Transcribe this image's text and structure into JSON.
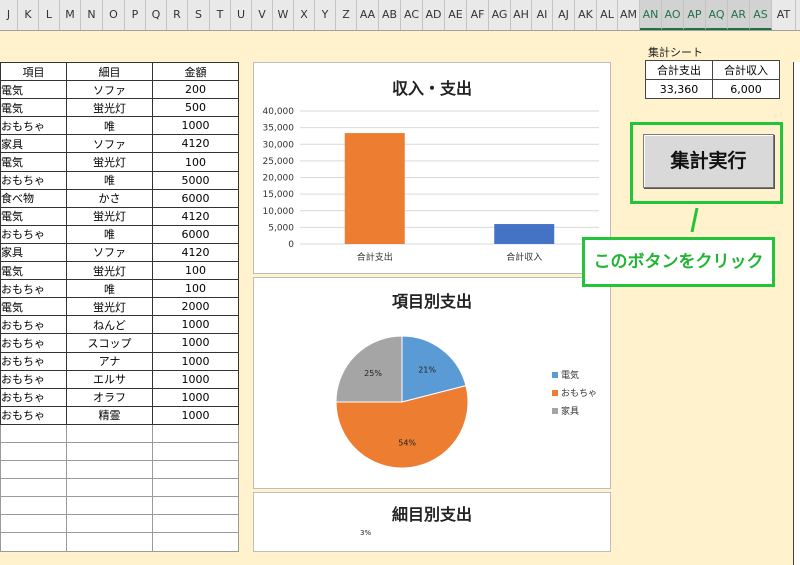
{
  "columns": [
    "J",
    "K",
    "L",
    "M",
    "N",
    "O",
    "P",
    "Q",
    "R",
    "S",
    "T",
    "U",
    "V",
    "W",
    "X",
    "Y",
    "Z",
    "AA",
    "AB",
    "AC",
    "AD",
    "AE",
    "AF",
    "AG",
    "AH",
    "AI",
    "AJ",
    "AK",
    "AL",
    "AM",
    "AN",
    "AO",
    "AP",
    "AQ",
    "AR",
    "AS",
    "AT"
  ],
  "selected_columns": [
    "AN",
    "AO",
    "AP",
    "AQ",
    "AR",
    "AS"
  ],
  "table": {
    "headers": [
      "項目",
      "細目",
      "金額"
    ],
    "rows": [
      [
        "電気",
        "ソファ",
        "200"
      ],
      [
        "電気",
        "蛍光灯",
        "500"
      ],
      [
        "おもちゃ",
        "唯",
        "1000"
      ],
      [
        "家具",
        "ソファ",
        "4120"
      ],
      [
        "電気",
        "蛍光灯",
        "100"
      ],
      [
        "おもちゃ",
        "唯",
        "5000"
      ],
      [
        "食べ物",
        "かさ",
        "6000"
      ],
      [
        "電気",
        "蛍光灯",
        "4120"
      ],
      [
        "おもちゃ",
        "唯",
        "6000"
      ],
      [
        "家具",
        "ソファ",
        "4120"
      ],
      [
        "電気",
        "蛍光灯",
        "100"
      ],
      [
        "おもちゃ",
        "唯",
        "100"
      ],
      [
        "電気",
        "蛍光灯",
        "2000"
      ],
      [
        "おもちゃ",
        "ねんど",
        "1000"
      ],
      [
        "おもちゃ",
        "スコップ",
        "1000"
      ],
      [
        "おもちゃ",
        "アナ",
        "1000"
      ],
      [
        "おもちゃ",
        "エルサ",
        "1000"
      ],
      [
        "おもちゃ",
        "オラフ",
        "1000"
      ],
      [
        "おもちゃ",
        "精霊",
        "1000"
      ]
    ]
  },
  "summary": {
    "label": "集計シート",
    "headers": [
      "合計支出",
      "合計収入"
    ],
    "values": [
      "33,360",
      "6,000"
    ]
  },
  "button": {
    "label": "集計実行"
  },
  "callout": {
    "text": "このボタンをクリック"
  },
  "colors": {
    "accent_green": "#22c53a",
    "orange": "#ed7d31",
    "blue": "#4472c4",
    "pie_blue": "#5b9bd5",
    "gray": "#a5a5a5"
  },
  "chart_data": [
    {
      "type": "bar",
      "title": "収入・支出",
      "categories": [
        "合計支出",
        "合計収入"
      ],
      "values": [
        33360,
        6000
      ],
      "bar_colors": [
        "#ed7d31",
        "#4472c4"
      ],
      "ylim": [
        0,
        40000
      ],
      "yticks": [
        "0",
        "5,000",
        "10,000",
        "15,000",
        "20,000",
        "25,000",
        "30,000",
        "35,000",
        "40,000"
      ],
      "grid": true
    },
    {
      "type": "pie",
      "title": "項目別支出",
      "labels": [
        "電気",
        "おもちゃ",
        "家具"
      ],
      "values": [
        21,
        54,
        25
      ],
      "value_labels": [
        "21%",
        "54%",
        "25%"
      ],
      "colors": [
        "#5b9bd5",
        "#ed7d31",
        "#a5a5a5"
      ],
      "legend": "right"
    },
    {
      "type": "pie",
      "title": "細目別支出",
      "value_labels": [
        "3%"
      ]
    }
  ]
}
